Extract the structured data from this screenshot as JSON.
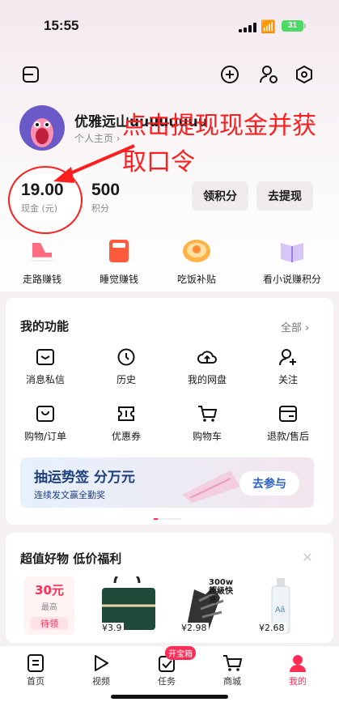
{
  "status_bar": {
    "time": "15:55",
    "battery": "31"
  },
  "header_icons": [
    "menu-icon",
    "add-icon",
    "user-settings-icon",
    "settings-icon"
  ],
  "profile": {
    "username": "优雅远山uuuuuuuu",
    "profile_link": "个人主页 ›"
  },
  "annotation": {
    "text": "点击提现现金并获取口令",
    "color": "#ff1e1e"
  },
  "wallet": {
    "cash_value": "19.00",
    "cash_label": "现金 (元)",
    "points_value": "500",
    "points_label": "积分",
    "earn_points_button": "领积分",
    "withdraw_button": "去提现"
  },
  "quick_actions": [
    {
      "label": "走路赚钱",
      "icon": "sneaker-icon",
      "color": "#ff6b7f"
    },
    {
      "label": "睡觉赚钱",
      "icon": "sleep-icon",
      "color": "#ff5a3c"
    },
    {
      "label": "吃饭补贴",
      "icon": "food-bowl-icon",
      "color": "#ffb347"
    },
    {
      "label": "看小说赚积分",
      "icon": "book-icon",
      "color": "#b99cf0"
    }
  ],
  "functions": {
    "title": "我的功能",
    "all_link": "全部 ›",
    "items": [
      {
        "label": "消息私信",
        "icon": "message-icon"
      },
      {
        "label": "历史",
        "icon": "clock-icon"
      },
      {
        "label": "我的网盘",
        "icon": "cloud-upload-icon"
      },
      {
        "label": "关注",
        "icon": "add-friend-icon"
      },
      {
        "label": "购物/订单",
        "icon": "order-box-icon"
      },
      {
        "label": "优惠券",
        "icon": "coupon-icon"
      },
      {
        "label": "购物车",
        "icon": "cart-icon"
      },
      {
        "label": "退款/售后",
        "icon": "refund-icon"
      }
    ]
  },
  "banner": {
    "title": "抽运势签 分万元",
    "subtitle": "连续发文赢全勤奖",
    "button": "去参与"
  },
  "deals": {
    "title": "超值好物 低价福利",
    "coupon": {
      "amount": "30元",
      "desc": "最高",
      "action": "待领"
    },
    "products": [
      {
        "price": "¥3.9",
        "icon": "storage-bag-icon"
      },
      {
        "price": "¥2.98",
        "icon": "robot-glove-icon",
        "promo": "300w 超级快充"
      },
      {
        "price": "¥2.68",
        "icon": "spray-bottle-icon"
      }
    ]
  },
  "nav": {
    "items": [
      {
        "label": "首页",
        "icon": "home-doc-icon"
      },
      {
        "label": "视频",
        "icon": "play-icon"
      },
      {
        "label": "任务",
        "icon": "task-check-icon",
        "badge": "开宝箱"
      },
      {
        "label": "商城",
        "icon": "shop-cart-icon"
      },
      {
        "label": "我的",
        "icon": "person-icon"
      }
    ],
    "active_color": "#ff2c55"
  }
}
